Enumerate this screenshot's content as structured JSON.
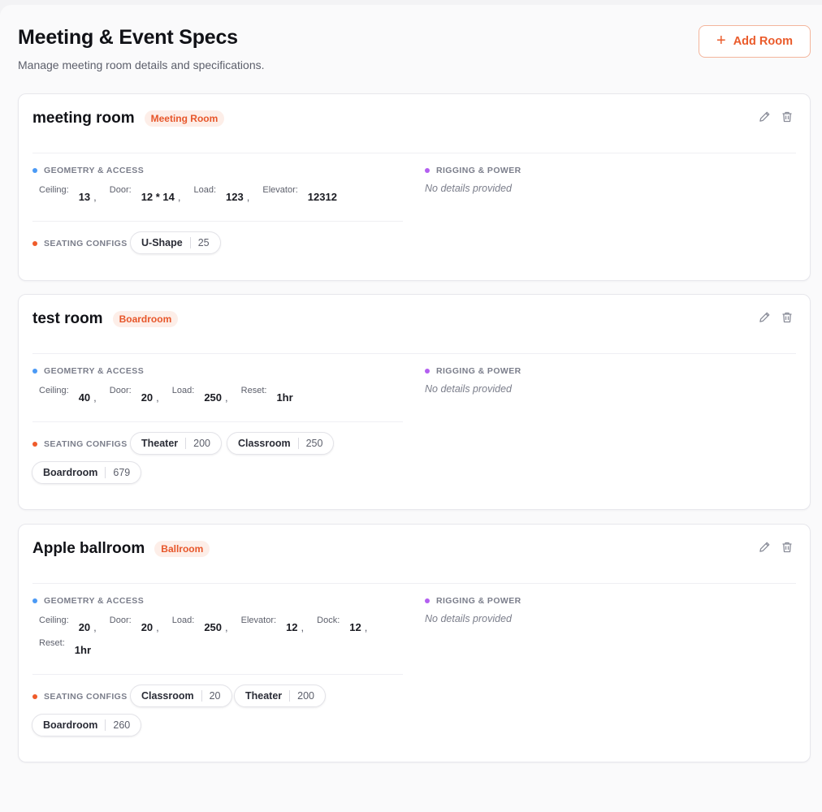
{
  "header": {
    "title": "Meeting & Event Specs",
    "subtitle": "Manage meeting room details and specifications.",
    "add_button_label": "Add Room",
    "add_button_icon": "plus-icon"
  },
  "section_labels": {
    "geometry": "GEOMETRY & ACCESS",
    "rigging": "RIGGING & POWER",
    "seating": "SEATING CONFIGS"
  },
  "no_details_text": "No details provided",
  "colors": {
    "accent": "#ea5b2b",
    "badge_bg": "#fdeee8",
    "geometry_dot": "#4b9af5",
    "rigging_dot": "#b35ff0",
    "seating_dot": "#ef5b2a"
  },
  "rooms": [
    {
      "name": "meeting room",
      "type": "Meeting Room",
      "specs": [
        {
          "label": "Ceiling:",
          "value": "13"
        },
        {
          "label": "Door:",
          "value": "12 * 14"
        },
        {
          "label": "Load:",
          "value": "123"
        },
        {
          "label": "Elevator:",
          "value": "12312"
        }
      ],
      "seating": [
        {
          "name": "U-Shape",
          "count": "25"
        }
      ]
    },
    {
      "name": "test room",
      "type": "Boardroom",
      "specs": [
        {
          "label": "Ceiling:",
          "value": "40"
        },
        {
          "label": "Door:",
          "value": "20"
        },
        {
          "label": "Load:",
          "value": "250"
        },
        {
          "label": "Reset:",
          "value": "1hr"
        }
      ],
      "seating": [
        {
          "name": "Theater",
          "count": "200"
        },
        {
          "name": "Classroom",
          "count": "250"
        },
        {
          "name": "Boardroom",
          "count": "679"
        }
      ]
    },
    {
      "name": "Apple ballroom",
      "type": "Ballroom",
      "specs": [
        {
          "label": "Ceiling:",
          "value": "20"
        },
        {
          "label": "Door:",
          "value": "20"
        },
        {
          "label": "Load:",
          "value": "250"
        },
        {
          "label": "Elevator:",
          "value": "12"
        },
        {
          "label": "Dock:",
          "value": "12"
        },
        {
          "label": "Reset:",
          "value": "1hr"
        }
      ],
      "seating": [
        {
          "name": "Classroom",
          "count": "20"
        },
        {
          "name": "Theater",
          "count": "200"
        },
        {
          "name": "Boardroom",
          "count": "260"
        }
      ]
    }
  ]
}
